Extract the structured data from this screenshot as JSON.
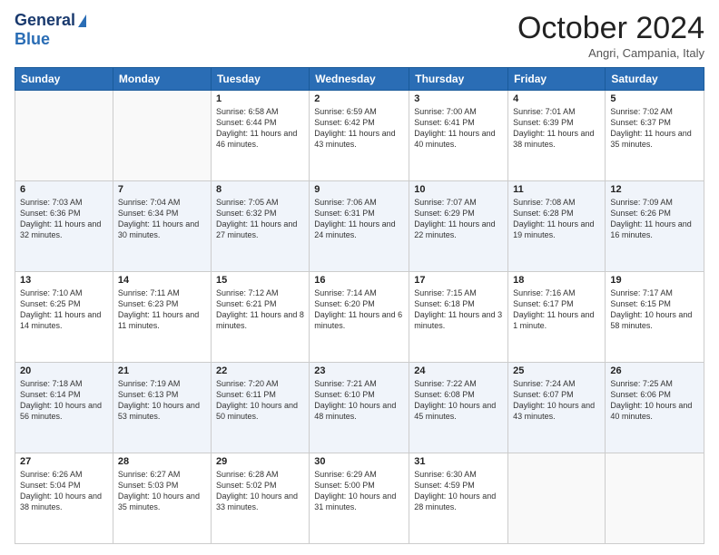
{
  "logo": {
    "line1": "General",
    "line2": "Blue"
  },
  "title": "October 2024",
  "location": "Angri, Campania, Italy",
  "days_of_week": [
    "Sunday",
    "Monday",
    "Tuesday",
    "Wednesday",
    "Thursday",
    "Friday",
    "Saturday"
  ],
  "weeks": [
    [
      {
        "day": "",
        "sunrise": "",
        "sunset": "",
        "daylight": ""
      },
      {
        "day": "",
        "sunrise": "",
        "sunset": "",
        "daylight": ""
      },
      {
        "day": "1",
        "sunrise": "Sunrise: 6:58 AM",
        "sunset": "Sunset: 6:44 PM",
        "daylight": "Daylight: 11 hours and 46 minutes."
      },
      {
        "day": "2",
        "sunrise": "Sunrise: 6:59 AM",
        "sunset": "Sunset: 6:42 PM",
        "daylight": "Daylight: 11 hours and 43 minutes."
      },
      {
        "day": "3",
        "sunrise": "Sunrise: 7:00 AM",
        "sunset": "Sunset: 6:41 PM",
        "daylight": "Daylight: 11 hours and 40 minutes."
      },
      {
        "day": "4",
        "sunrise": "Sunrise: 7:01 AM",
        "sunset": "Sunset: 6:39 PM",
        "daylight": "Daylight: 11 hours and 38 minutes."
      },
      {
        "day": "5",
        "sunrise": "Sunrise: 7:02 AM",
        "sunset": "Sunset: 6:37 PM",
        "daylight": "Daylight: 11 hours and 35 minutes."
      }
    ],
    [
      {
        "day": "6",
        "sunrise": "Sunrise: 7:03 AM",
        "sunset": "Sunset: 6:36 PM",
        "daylight": "Daylight: 11 hours and 32 minutes."
      },
      {
        "day": "7",
        "sunrise": "Sunrise: 7:04 AM",
        "sunset": "Sunset: 6:34 PM",
        "daylight": "Daylight: 11 hours and 30 minutes."
      },
      {
        "day": "8",
        "sunrise": "Sunrise: 7:05 AM",
        "sunset": "Sunset: 6:32 PM",
        "daylight": "Daylight: 11 hours and 27 minutes."
      },
      {
        "day": "9",
        "sunrise": "Sunrise: 7:06 AM",
        "sunset": "Sunset: 6:31 PM",
        "daylight": "Daylight: 11 hours and 24 minutes."
      },
      {
        "day": "10",
        "sunrise": "Sunrise: 7:07 AM",
        "sunset": "Sunset: 6:29 PM",
        "daylight": "Daylight: 11 hours and 22 minutes."
      },
      {
        "day": "11",
        "sunrise": "Sunrise: 7:08 AM",
        "sunset": "Sunset: 6:28 PM",
        "daylight": "Daylight: 11 hours and 19 minutes."
      },
      {
        "day": "12",
        "sunrise": "Sunrise: 7:09 AM",
        "sunset": "Sunset: 6:26 PM",
        "daylight": "Daylight: 11 hours and 16 minutes."
      }
    ],
    [
      {
        "day": "13",
        "sunrise": "Sunrise: 7:10 AM",
        "sunset": "Sunset: 6:25 PM",
        "daylight": "Daylight: 11 hours and 14 minutes."
      },
      {
        "day": "14",
        "sunrise": "Sunrise: 7:11 AM",
        "sunset": "Sunset: 6:23 PM",
        "daylight": "Daylight: 11 hours and 11 minutes."
      },
      {
        "day": "15",
        "sunrise": "Sunrise: 7:12 AM",
        "sunset": "Sunset: 6:21 PM",
        "daylight": "Daylight: 11 hours and 8 minutes."
      },
      {
        "day": "16",
        "sunrise": "Sunrise: 7:14 AM",
        "sunset": "Sunset: 6:20 PM",
        "daylight": "Daylight: 11 hours and 6 minutes."
      },
      {
        "day": "17",
        "sunrise": "Sunrise: 7:15 AM",
        "sunset": "Sunset: 6:18 PM",
        "daylight": "Daylight: 11 hours and 3 minutes."
      },
      {
        "day": "18",
        "sunrise": "Sunrise: 7:16 AM",
        "sunset": "Sunset: 6:17 PM",
        "daylight": "Daylight: 11 hours and 1 minute."
      },
      {
        "day": "19",
        "sunrise": "Sunrise: 7:17 AM",
        "sunset": "Sunset: 6:15 PM",
        "daylight": "Daylight: 10 hours and 58 minutes."
      }
    ],
    [
      {
        "day": "20",
        "sunrise": "Sunrise: 7:18 AM",
        "sunset": "Sunset: 6:14 PM",
        "daylight": "Daylight: 10 hours and 56 minutes."
      },
      {
        "day": "21",
        "sunrise": "Sunrise: 7:19 AM",
        "sunset": "Sunset: 6:13 PM",
        "daylight": "Daylight: 10 hours and 53 minutes."
      },
      {
        "day": "22",
        "sunrise": "Sunrise: 7:20 AM",
        "sunset": "Sunset: 6:11 PM",
        "daylight": "Daylight: 10 hours and 50 minutes."
      },
      {
        "day": "23",
        "sunrise": "Sunrise: 7:21 AM",
        "sunset": "Sunset: 6:10 PM",
        "daylight": "Daylight: 10 hours and 48 minutes."
      },
      {
        "day": "24",
        "sunrise": "Sunrise: 7:22 AM",
        "sunset": "Sunset: 6:08 PM",
        "daylight": "Daylight: 10 hours and 45 minutes."
      },
      {
        "day": "25",
        "sunrise": "Sunrise: 7:24 AM",
        "sunset": "Sunset: 6:07 PM",
        "daylight": "Daylight: 10 hours and 43 minutes."
      },
      {
        "day": "26",
        "sunrise": "Sunrise: 7:25 AM",
        "sunset": "Sunset: 6:06 PM",
        "daylight": "Daylight: 10 hours and 40 minutes."
      }
    ],
    [
      {
        "day": "27",
        "sunrise": "Sunrise: 6:26 AM",
        "sunset": "Sunset: 5:04 PM",
        "daylight": "Daylight: 10 hours and 38 minutes."
      },
      {
        "day": "28",
        "sunrise": "Sunrise: 6:27 AM",
        "sunset": "Sunset: 5:03 PM",
        "daylight": "Daylight: 10 hours and 35 minutes."
      },
      {
        "day": "29",
        "sunrise": "Sunrise: 6:28 AM",
        "sunset": "Sunset: 5:02 PM",
        "daylight": "Daylight: 10 hours and 33 minutes."
      },
      {
        "day": "30",
        "sunrise": "Sunrise: 6:29 AM",
        "sunset": "Sunset: 5:00 PM",
        "daylight": "Daylight: 10 hours and 31 minutes."
      },
      {
        "day": "31",
        "sunrise": "Sunrise: 6:30 AM",
        "sunset": "Sunset: 4:59 PM",
        "daylight": "Daylight: 10 hours and 28 minutes."
      },
      {
        "day": "",
        "sunrise": "",
        "sunset": "",
        "daylight": ""
      },
      {
        "day": "",
        "sunrise": "",
        "sunset": "",
        "daylight": ""
      }
    ]
  ]
}
